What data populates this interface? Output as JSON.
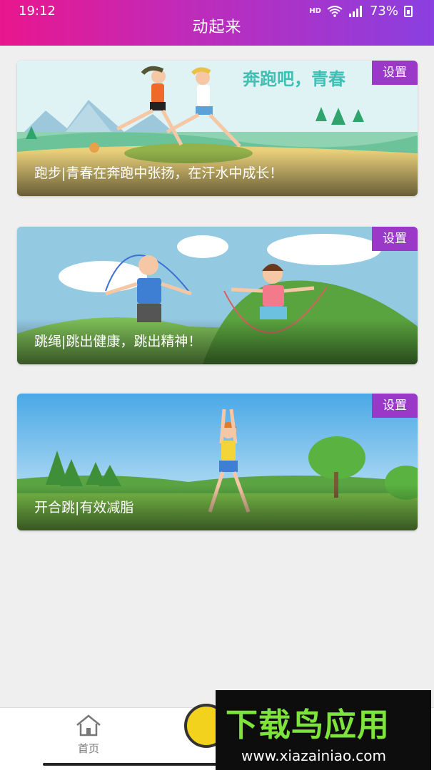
{
  "status_bar": {
    "time": "19:12",
    "network": "HD",
    "signal": "4G",
    "battery": "73%"
  },
  "header": {
    "title": "动起来"
  },
  "cards": [
    {
      "caption": "跑步|青春在奔跑中张扬，在汗水中成长！",
      "setting_label": "设置",
      "art_text": "奔跑吧，青春"
    },
    {
      "caption": "跳绳|跳出健康，跳出精神！",
      "setting_label": "设置"
    },
    {
      "caption": "开合跳|有效减脂",
      "setting_label": "设置"
    }
  ],
  "bottom_nav": {
    "home_label": "首页"
  },
  "watermark": {
    "title": "下载鸟应用",
    "url": "www.xiazainiao.com"
  }
}
